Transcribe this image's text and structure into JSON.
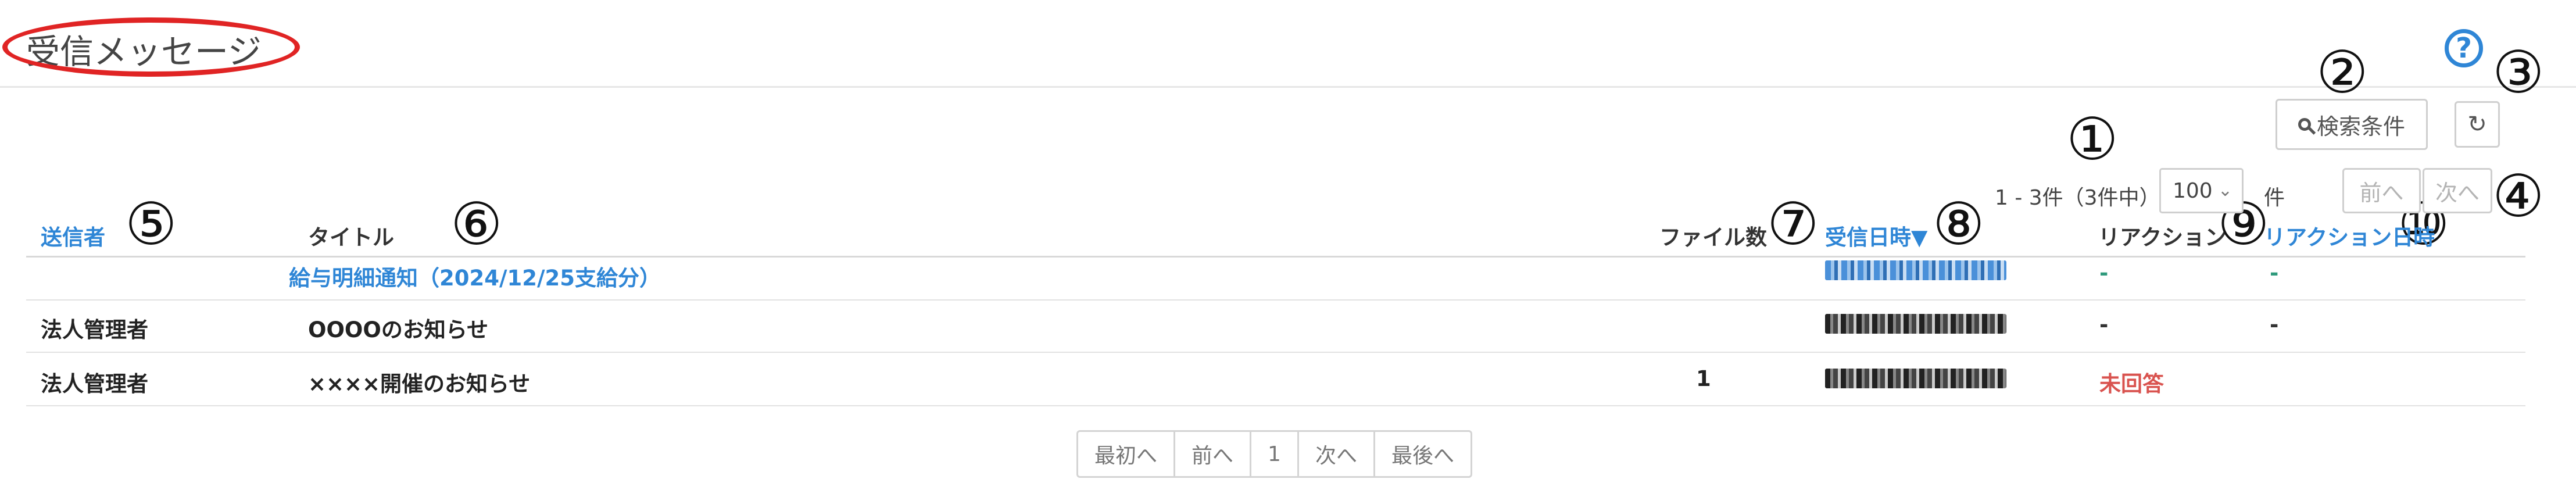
{
  "page": {
    "title": "受信メッセージ"
  },
  "annotations": [
    "①",
    "②",
    "③",
    "④",
    "⑤",
    "⑥",
    "⑦",
    "⑧",
    "⑨",
    "⑩"
  ],
  "toolbar": {
    "search_label": "検索条件",
    "help_symbol": "?",
    "refresh_symbol": "↻"
  },
  "paging_info": {
    "range_text": "1 - 3件（3件中）",
    "page_size": "100",
    "page_size_unit": "件",
    "prev_label": "前へ",
    "next_label": "次へ"
  },
  "table": {
    "headers": {
      "sender": "送信者",
      "title": "タイトル",
      "file_count": "ファイル数",
      "received_at": "受信日時▼",
      "reaction": "リアクション",
      "reaction_at": "リアクション日時"
    },
    "rows": [
      {
        "sender": "",
        "title": "給与明細通知（2024/12/25支給分）",
        "file_count": "",
        "reaction": "-",
        "reaction_at": "-"
      },
      {
        "sender": "法人管理者",
        "title": "OOOOのお知らせ",
        "file_count": "",
        "reaction": "-",
        "reaction_at": "-"
      },
      {
        "sender": "法人管理者",
        "title": "××××開催のお知らせ",
        "file_count": "1",
        "reaction": "未回答",
        "reaction_at": ""
      }
    ]
  },
  "pagination": {
    "first": "最初へ",
    "prev": "前へ",
    "current": "1",
    "next": "次へ",
    "last": "最後へ"
  }
}
